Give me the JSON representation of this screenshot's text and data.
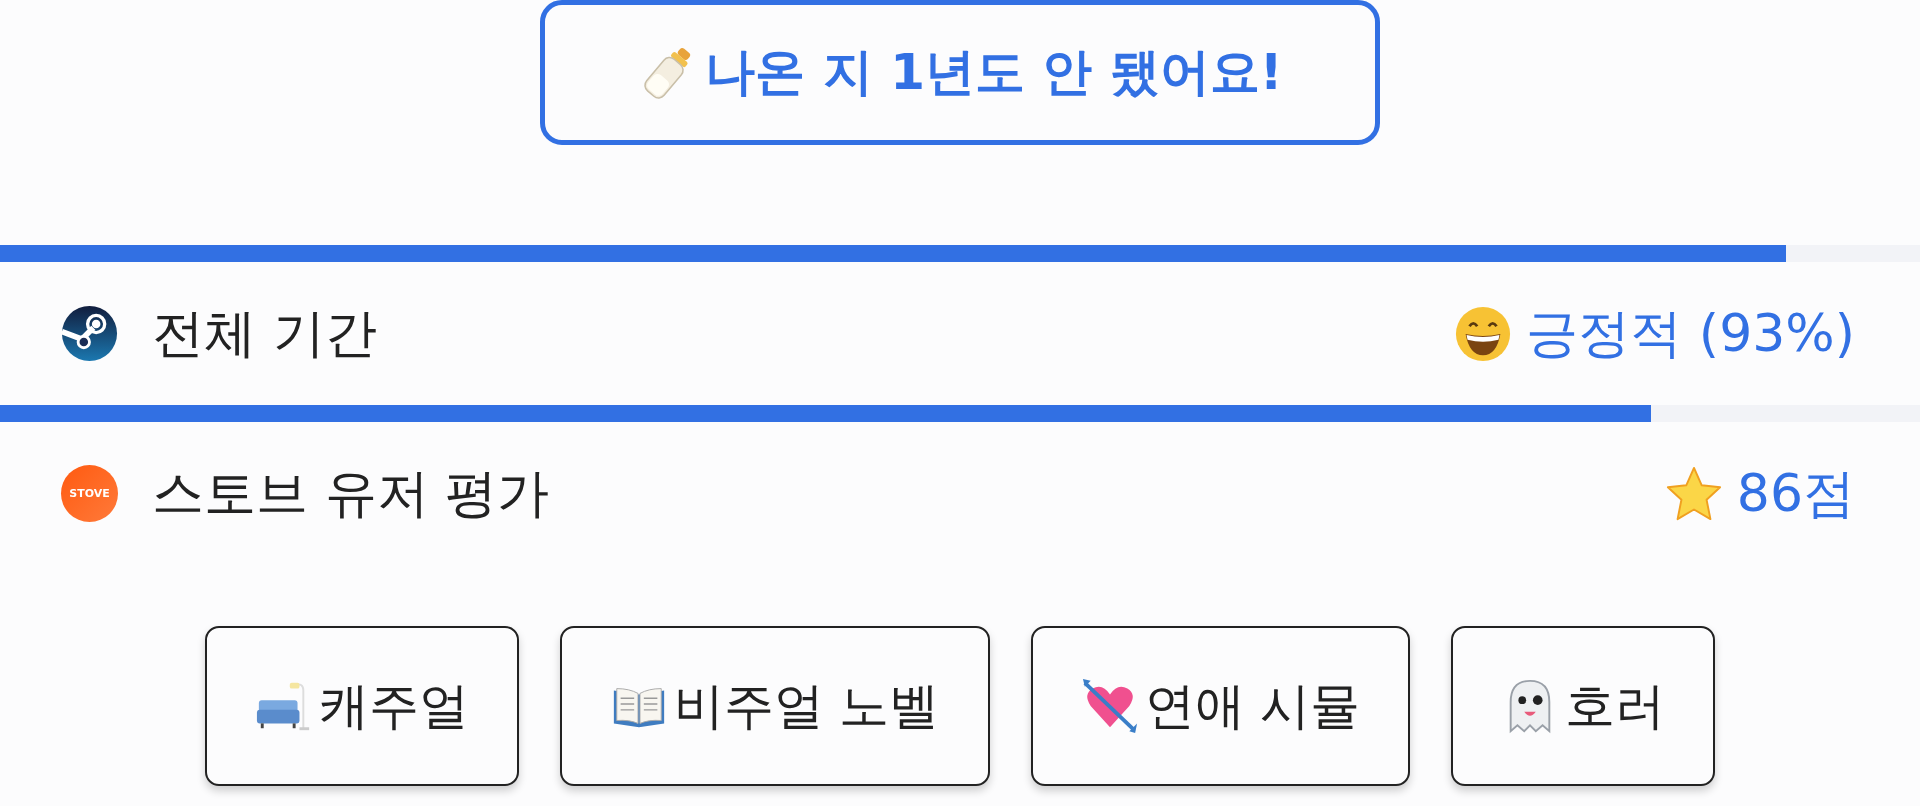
{
  "badge": {
    "text": "나온 지 1년도 안 됐어요!"
  },
  "ratings": [
    {
      "label": "전체 기간",
      "level": 0.93,
      "value": "긍정적 (93%)"
    },
    {
      "label": "스토브 유저 평가",
      "logo_text": "STOVE",
      "level": 0.86,
      "value": "86점"
    }
  ],
  "tags": [
    {
      "label": "캐주얼"
    },
    {
      "label": "비주얼 노벨"
    },
    {
      "label": "연애 시뮬"
    },
    {
      "label": "호러"
    }
  ]
}
